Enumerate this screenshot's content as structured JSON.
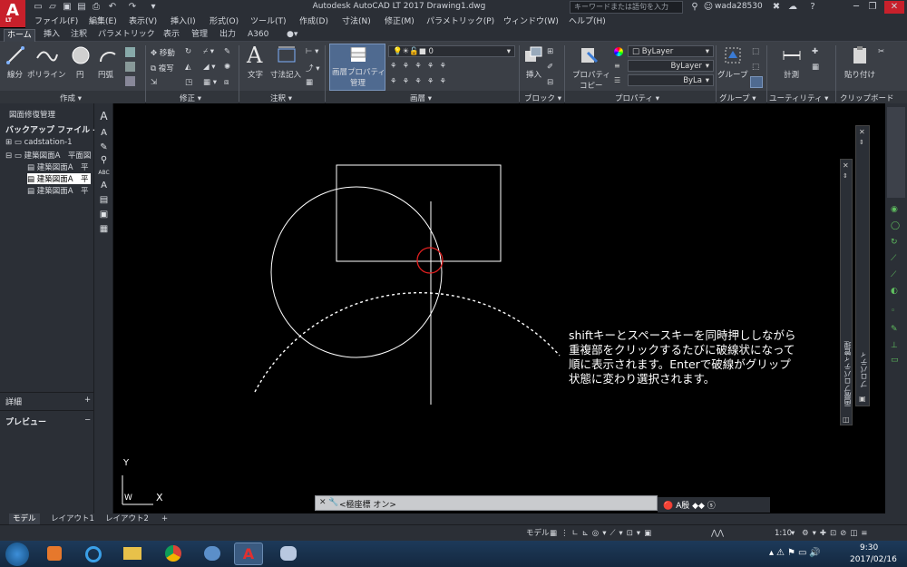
{
  "app": {
    "logo_letter": "A",
    "logo_sub": "LT",
    "window_title": "Autodesk AutoCAD LT 2017     Drawing1.dwg",
    "search_placeholder": "キーワードまたは語句を入力",
    "user": "wada28530"
  },
  "menu": [
    "ファイル(F)",
    "編集(E)",
    "表示(V)",
    "挿入(I)",
    "形式(O)",
    "ツール(T)",
    "作成(D)",
    "寸法(N)",
    "修正(M)",
    "パラメトリック(P)",
    "ウィンドウ(W)",
    "ヘルプ(H)"
  ],
  "ribbon_tabs": [
    "ホーム",
    "挿入",
    "注釈",
    "パラメトリック",
    "表示",
    "管理",
    "出力",
    "A360"
  ],
  "ribbon": {
    "draw": {
      "line": "線分",
      "polyline": "ポリライン",
      "circle": "円",
      "arc": "円弧",
      "panel": "作成 ▾"
    },
    "modify": {
      "move": "移動",
      "copy": "複写",
      "panel": "修正 ▾"
    },
    "annotation": {
      "text": "文字",
      "dimension": "寸法記入",
      "panel": "注釈 ▾"
    },
    "layers": {
      "props_line1": "画層プロパティ",
      "props_line2": "管理",
      "current_layer": "0",
      "panel": "画層 ▾"
    },
    "block": {
      "insert": "挿入",
      "panel": "ブロック ▾"
    },
    "properties": {
      "copy_line1": "プロパティ",
      "copy_line2": "コピー",
      "color": "ByLayer",
      "linetype": "ByLayer",
      "lineweight": "ByLa",
      "panel": "プロパティ ▾"
    },
    "groups": {
      "group": "グループ",
      "panel": "グループ ▾"
    },
    "utilities": {
      "measure": "計測",
      "panel": "ユーティリティ ▾"
    },
    "clipboard": {
      "paste": "貼り付け",
      "panel": "クリップボード"
    }
  },
  "left_panel": {
    "header": "図面修復管理",
    "backup_title": "バックアップ ファイル -",
    "tree": [
      "cadstation-1",
      "建築図面A　平面図",
      "建築図面A　平",
      "建築図面A　平",
      "建築図面A　平"
    ],
    "details": "詳細",
    "preview": "プレビュー"
  },
  "layout_tabs": [
    "モデル",
    "レイアウト1",
    "レイアウト2"
  ],
  "command": {
    "text": "<極座標 オン>"
  },
  "status": {
    "model": "モデル",
    "scale": "1:10"
  },
  "annotation_note": "shiftキーとスペースキーを同時押ししながら\n重複部をクリックするたびに破線状になって\n順に表示されます。Enterで破線がグリップ\n状態に変わり選択されます。",
  "ucs": {
    "x": "X",
    "y": "Y",
    "w": "W"
  },
  "palettes": {
    "layer_props": "画層プロパティ管理",
    "properties": "プロパティ"
  },
  "clock": {
    "time": "9:30",
    "date": "2017/02/16"
  },
  "colors": {
    "accent_red": "#c8202b",
    "circle_marker": "#e02020",
    "canvas": "#000000"
  }
}
